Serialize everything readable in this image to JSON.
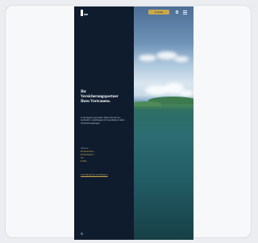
{
  "hero": {
    "title_lines": [
      "Ihr",
      "Versicherungspartner",
      "Ihres Vertrauens."
    ],
    "description": "In der Region seit vielen Jahren für Sie da – persönlich, unabhängig und zuverlässig in allen Versicherungsfragen.",
    "cta": "Jetzt Beratung vereinbaren"
  },
  "header": {
    "cta_label": "Kontakt"
  },
  "info": {
    "label": "Adresse",
    "lines": [
      "Musterstrasse",
      "Musterhausen",
      "Tel.",
      "E-Mail"
    ]
  },
  "colors": {
    "panel": "#0f1c2e",
    "accent": "#c9a84a"
  }
}
